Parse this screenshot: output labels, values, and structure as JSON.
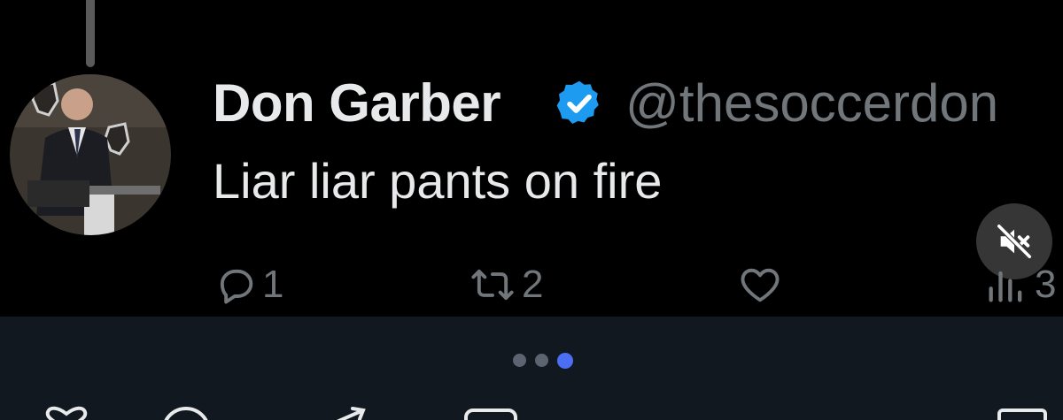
{
  "tweet": {
    "author_name": "Don Garber",
    "handle": "@thesoccerdon",
    "text": "Liar liar pants on fire",
    "verified": true
  },
  "actions": {
    "reply_count": "1",
    "retweet_count": "2",
    "like_count": "",
    "views_count": "3"
  },
  "pager": {
    "total": 3,
    "active_index": 2
  },
  "colors": {
    "background": "#000000",
    "name_text": "#e7e9ea",
    "secondary_text": "#71767b",
    "verified_badge": "#1d9bf0",
    "active_dot": "#4c6ef5",
    "bottom_bar": "#111820"
  },
  "icons": {
    "reply": "reply-icon",
    "retweet": "retweet-icon",
    "like": "heart-icon",
    "views": "views-icon",
    "mute": "muted-speaker-icon",
    "verified": "verified-badge-icon"
  }
}
